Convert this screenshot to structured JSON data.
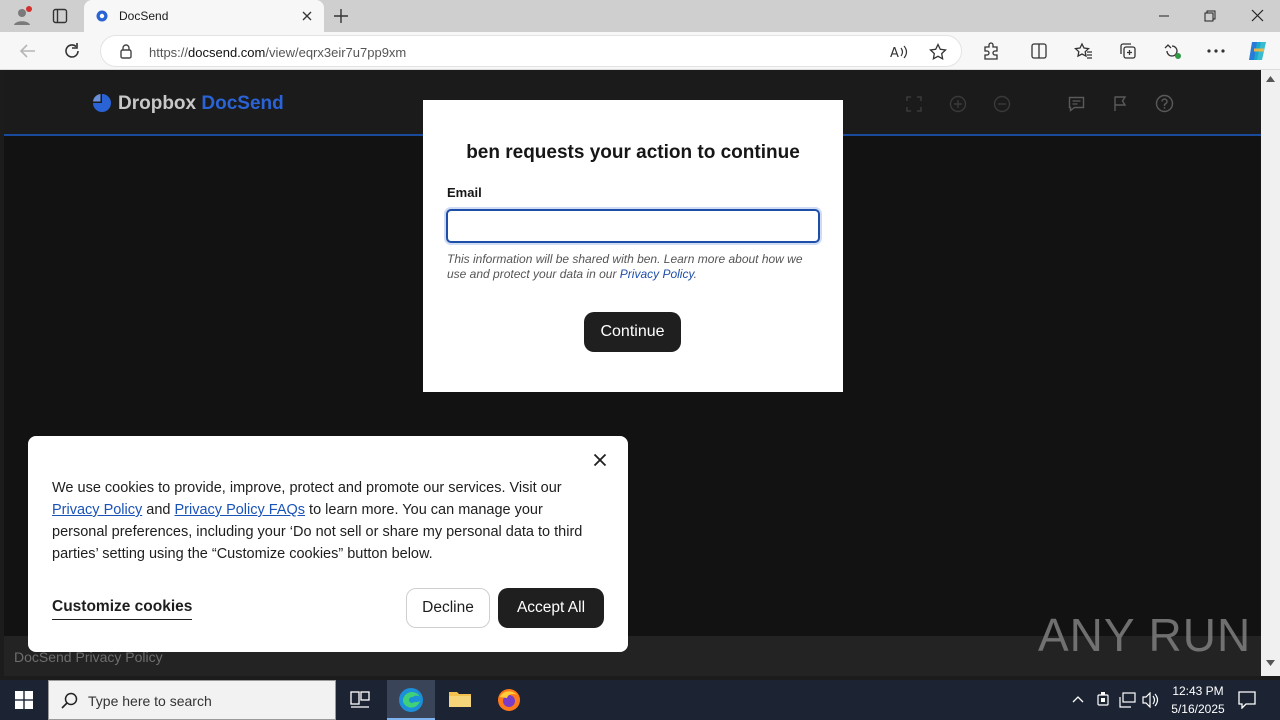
{
  "browser": {
    "tab_title": "DocSend",
    "url_prefix": "https://",
    "url_domain": "docsend.com",
    "url_path": "/view/eqrx3eir7u7pp9xm"
  },
  "header": {
    "logo_brand": "Dropbox",
    "logo_product": "DocSend"
  },
  "modal": {
    "title": "ben requests your action to continue",
    "email_label": "Email",
    "email_value": "",
    "disclaimer_text": "This information will be shared with ben. Learn more about how we use and protect your data in our ",
    "disclaimer_link": "Privacy Policy",
    "disclaimer_end": ".",
    "continue_label": "Continue"
  },
  "cookie": {
    "text_1": "We use cookies to provide, improve, protect and promote our services. Visit our ",
    "link_privacy": "Privacy Policy",
    "text_2": " and ",
    "link_faqs": "Privacy Policy FAQs",
    "text_3": " to learn more. You can manage your personal preferences, including your ‘Do not sell or share my personal data to third parties’ setting using the “Customize cookies” button below.",
    "customize_label": "Customize cookies",
    "decline_label": "Decline",
    "accept_label": "Accept All"
  },
  "footer": {
    "privacy_link": "DocSend Privacy Policy"
  },
  "taskbar": {
    "search_placeholder": "Type here to search",
    "time": "12:43 PM",
    "date": "5/16/2025"
  },
  "watermark": "ANY RUN",
  "colors": {
    "accent_blue": "#1e4fa8",
    "button_dark": "#1f1f1f",
    "page_bg": "#121212"
  }
}
